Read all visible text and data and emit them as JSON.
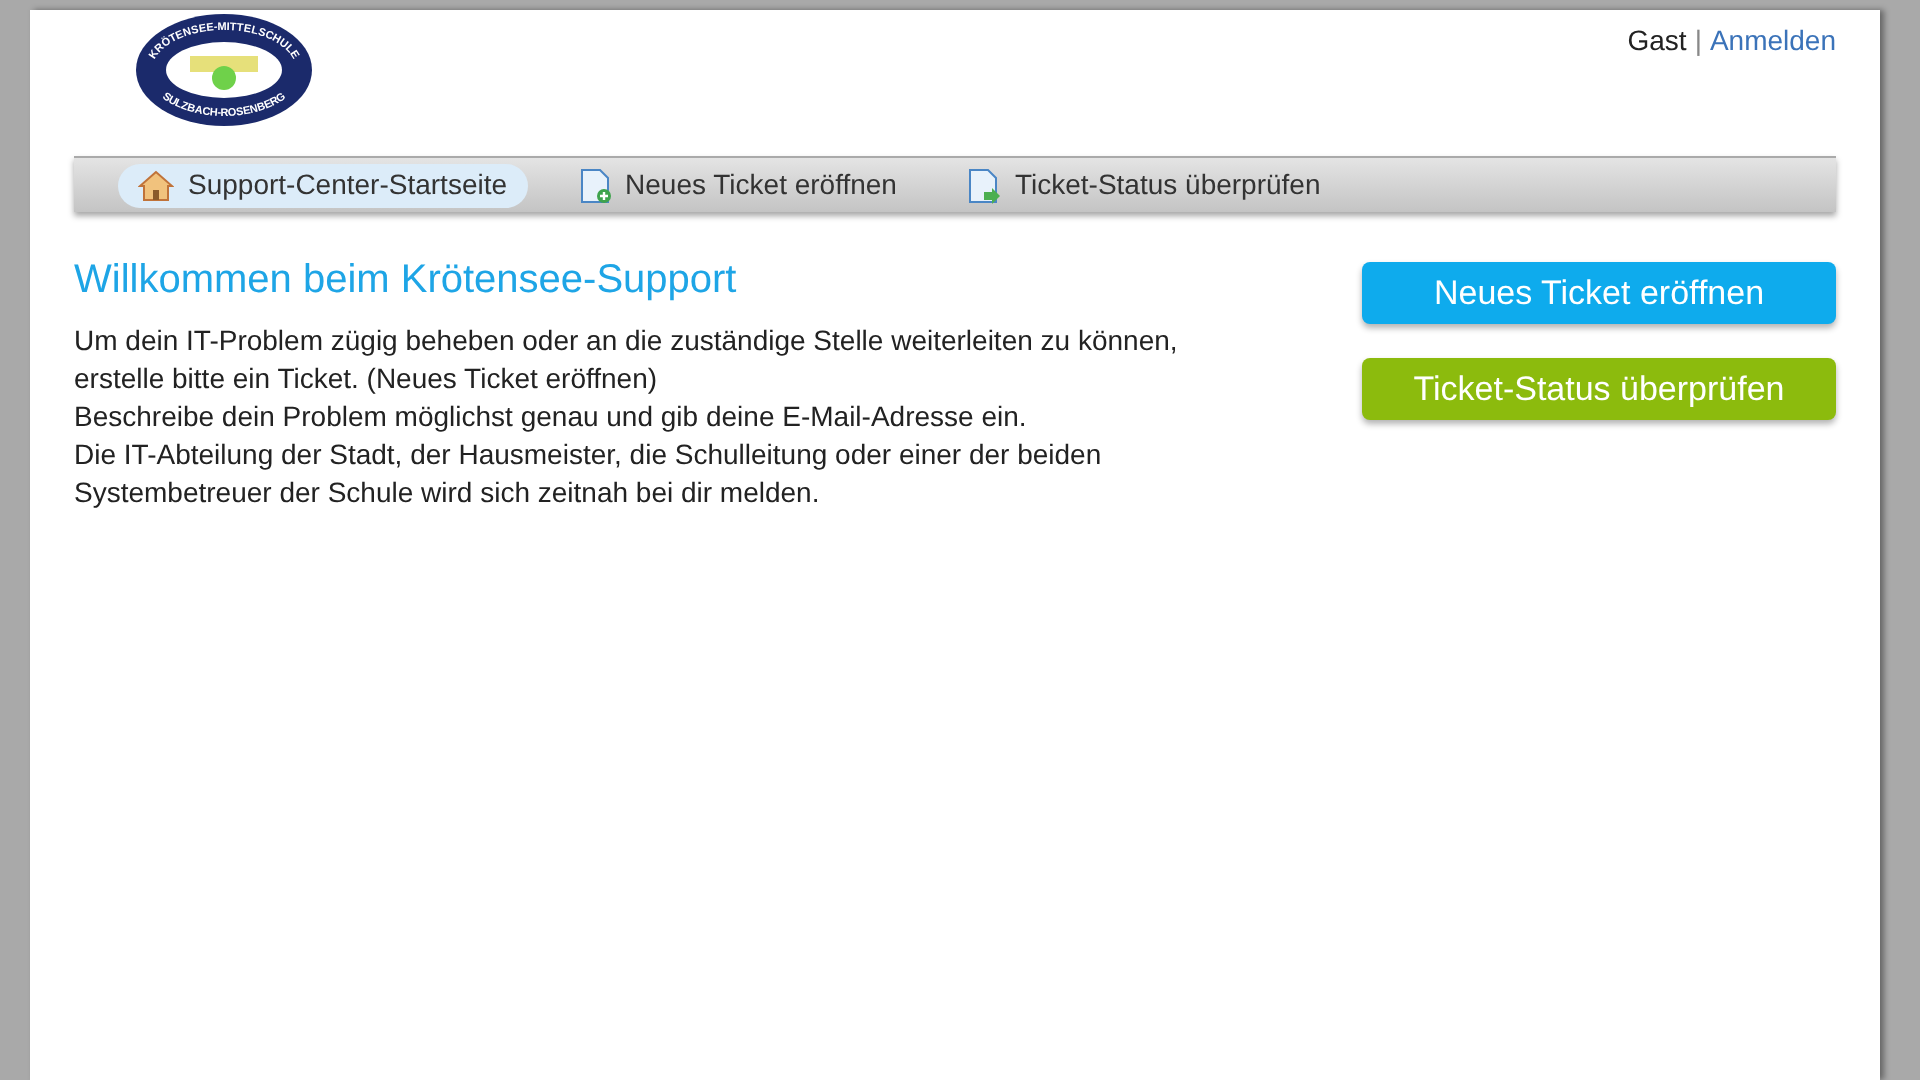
{
  "logo": {
    "top_text": "KRÖTENSEE-MITTELSCHULE",
    "bottom_text": "SULZBACH-ROSENBERG"
  },
  "user": {
    "name": "Gast",
    "separator": "|",
    "login": "Anmelden"
  },
  "nav": [
    {
      "label": "Support-Center-Startseite",
      "kind": "home",
      "selected": true
    },
    {
      "label": "Neues Ticket eröffnen",
      "kind": "new",
      "selected": false
    },
    {
      "label": "Ticket-Status überprüfen",
      "kind": "status",
      "selected": false
    }
  ],
  "heading": "Willkommen beim Krötensee-Support",
  "intro": [
    "Um dein IT-Problem zügig beheben oder an die zuständige Stelle weiterleiten zu können, erstelle bitte ein Ticket. (Neues Ticket eröffnen)",
    "Beschreibe dein Problem möglichst genau und gib deine E-Mail-Adresse ein.",
    "Die IT-Abteilung der Stadt, der Hausmeister, die Schulleitung oder einer der beiden Systembetreuer der Schule wird sich zeitnah bei dir melden."
  ],
  "actions": [
    {
      "label": "Neues Ticket eröffnen",
      "color": "#0eabed"
    },
    {
      "label": "Ticket-Status überprüfen",
      "color": "#8cbb0d"
    }
  ]
}
